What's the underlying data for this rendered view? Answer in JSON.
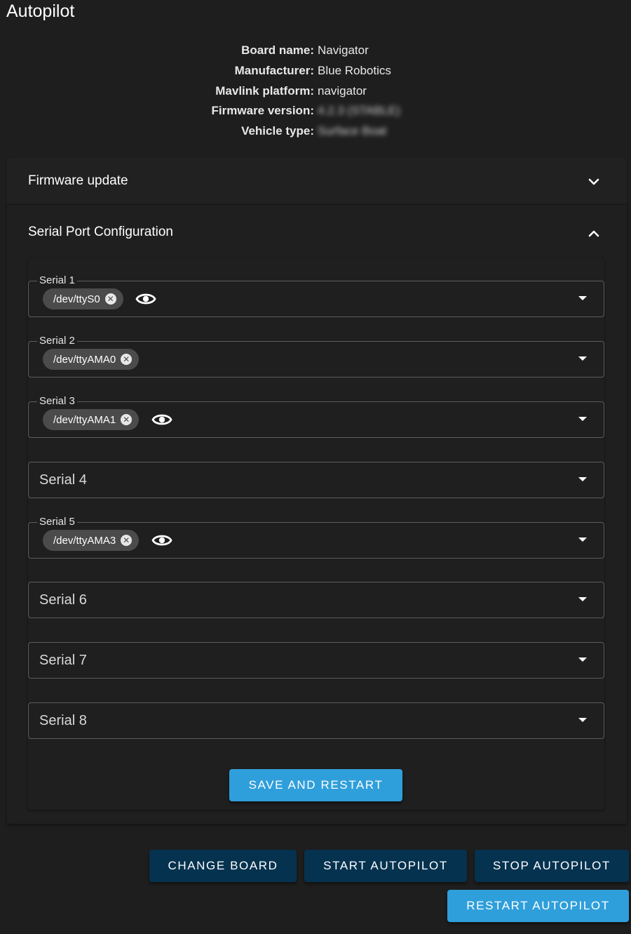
{
  "page": {
    "title": "Autopilot"
  },
  "info": [
    {
      "label": "Board name:",
      "value": "Navigator",
      "blurred": false
    },
    {
      "label": "Manufacturer:",
      "value": "Blue Robotics",
      "blurred": false
    },
    {
      "label": "Mavlink platform:",
      "value": "navigator",
      "blurred": false
    },
    {
      "label": "Firmware version:",
      "value": "4.2.3 (STABLE)",
      "blurred": true
    },
    {
      "label": "Vehicle type:",
      "value": "Surface Boat",
      "blurred": true
    }
  ],
  "firmware_panel": {
    "title": "Firmware update",
    "icon": "chevron-down-icon"
  },
  "serial_panel": {
    "title": "Serial Port Configuration",
    "icon": "chevron-up-icon",
    "ports": [
      {
        "label": "Serial 1",
        "value": "/dev/ttyS0",
        "has_eye": true
      },
      {
        "label": "Serial 2",
        "value": "/dev/ttyAMA0",
        "has_eye": false
      },
      {
        "label": "Serial 3",
        "value": "/dev/ttyAMA1",
        "has_eye": true
      },
      {
        "label": "Serial 4",
        "value": "",
        "has_eye": false
      },
      {
        "label": "Serial 5",
        "value": "/dev/ttyAMA3",
        "has_eye": true
      },
      {
        "label": "Serial 6",
        "value": "",
        "has_eye": false
      },
      {
        "label": "Serial 7",
        "value": "",
        "has_eye": false
      },
      {
        "label": "Serial 8",
        "value": "",
        "has_eye": false
      }
    ],
    "save_label": "SAVE AND RESTART"
  },
  "actions": {
    "change_board": "CHANGE BOARD",
    "start": "START AUTOPILOT",
    "stop": "STOP AUTOPILOT",
    "restart": "RESTART AUTOPILOT"
  },
  "colors": {
    "background": "#1e1e1e",
    "primary_button": "#2f9fdb",
    "dark_button": "#05324f",
    "chip": "#4b4b4b"
  }
}
